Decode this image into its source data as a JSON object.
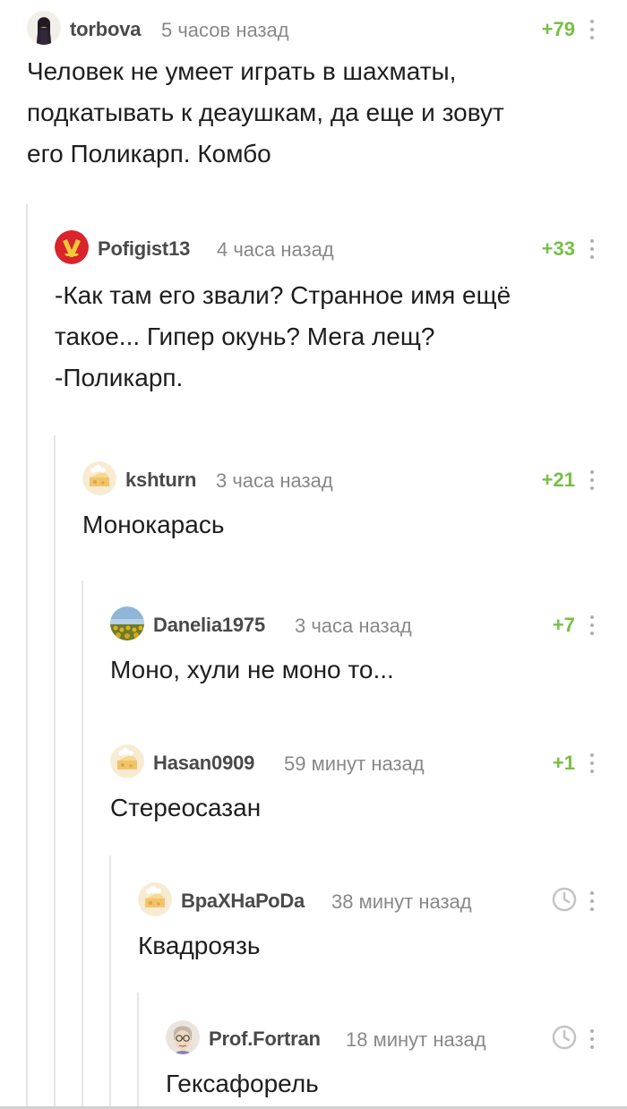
{
  "comments": [
    {
      "username": "torbova",
      "time": "5 часов назад",
      "rating": "+79",
      "avatar": "woman-photo-avatar",
      "text": "Человек не умеет играть в шахматы,\nподкатывать к деаушкам, да еще и зовут\nего Поликарп. Комбо"
    },
    {
      "username": "Pofigist13",
      "time": "4 часа назад",
      "rating": "+33",
      "avatar": "red-emblem-avatar",
      "text": "-Как там его звали? Странное имя ещё\nтакое... Гипер окунь? Мега лещ?\n-Поликарп."
    },
    {
      "username": "kshturn",
      "time": "3 часа назад",
      "rating": "+21",
      "avatar": "default-cheese-avatar",
      "text": "Монокарась"
    },
    {
      "username": "Danelia1975",
      "time": "3 часа назад",
      "rating": "+7",
      "avatar": "sunflower-field-avatar",
      "text": "Моно, хули не моно то..."
    },
    {
      "username": "Hasan0909",
      "time": "59 минут назад",
      "rating": "+1",
      "avatar": "default-cheese-avatar",
      "text": "Стереосазан"
    },
    {
      "username": "ВраХНаРоDа",
      "time": "38 минут назад",
      "rating": "",
      "avatar": "default-cheese-avatar",
      "status_icon": "clock-icon",
      "text": "Квадроязь"
    },
    {
      "username": "Prof.Fortran",
      "time": "18 минут назад",
      "rating": "",
      "avatar": "cartoon-professor-avatar",
      "status_icon": "clock-icon",
      "text": "Гексафорель"
    }
  ],
  "colors": {
    "rating": "#78bf45",
    "username": "#4a4a4a",
    "time": "#888888",
    "thread_line": "#e6e6e6"
  }
}
